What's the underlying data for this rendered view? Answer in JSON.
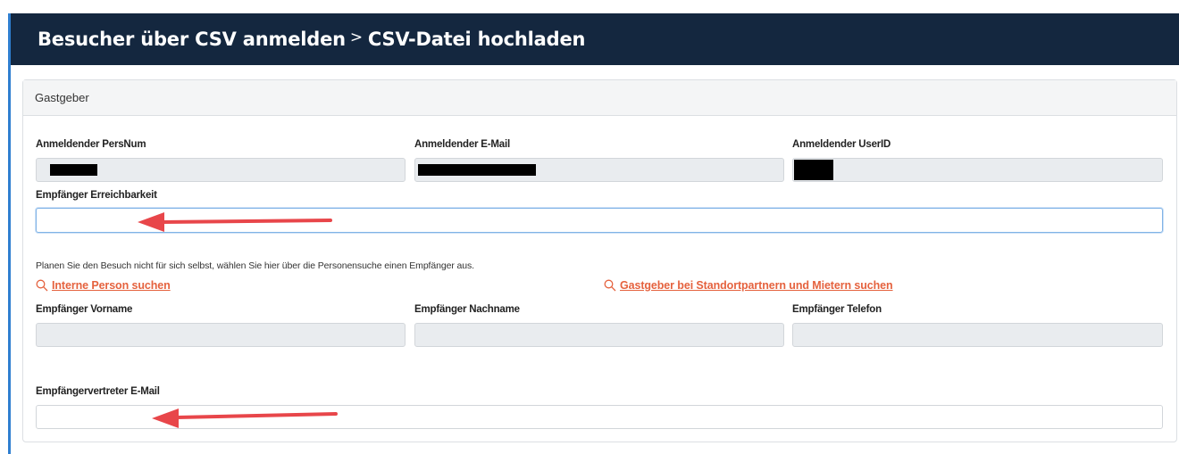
{
  "header": {
    "title": "Besucher über CSV anmelden",
    "separator": ">",
    "subtitle": "CSV-Datei hochladen"
  },
  "card": {
    "title": "Gastgeber"
  },
  "fields": {
    "pers_num_label": "Anmeldender PersNum",
    "email_label": "Anmeldender E-Mail",
    "userid_label": "Anmeldender UserID",
    "erreichbarkeit_label": "Empfänger Erreichbarkeit",
    "vorname_label": "Empfänger Vorname",
    "nachname_label": "Empfänger Nachname",
    "telefon_label": "Empfänger Telefon",
    "vertreter_email_label": "Empfängervertreter E-Mail"
  },
  "hint": "Planen Sie den Besuch nicht für sich selbst, wählen Sie hier über die Personensuche einen Empfänger aus.",
  "links": {
    "intern": "Interne Person suchen",
    "gastgeber": "Gastgeber bei Standortpartnern und Mietern suchen"
  },
  "icons": {
    "search": "search-icon",
    "arrow": "red-arrow-annotation"
  },
  "colors": {
    "header_bg": "#14273f",
    "accent": "#2f7fd0",
    "link": "#e5623e",
    "arrow": "#e8464a"
  }
}
